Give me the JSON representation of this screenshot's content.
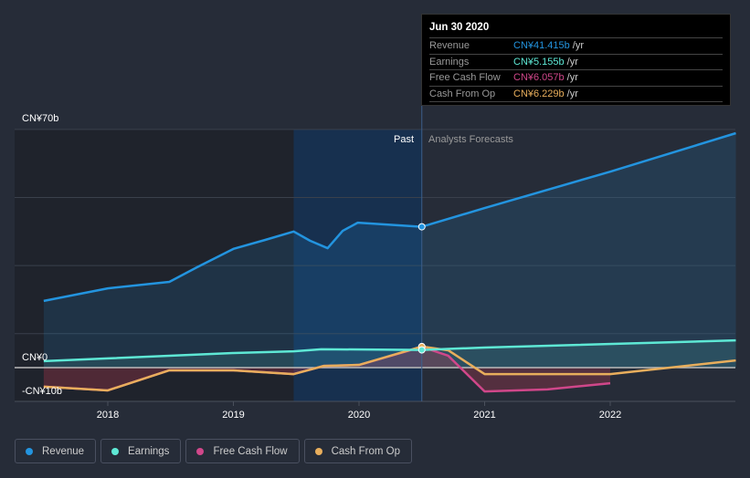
{
  "chart_data": {
    "type": "line",
    "y_unit": "CN¥ billions",
    "ylim": [
      -10,
      70
    ],
    "y_ticks": [
      {
        "v": 70,
        "label": "CN¥70b"
      },
      {
        "v": 0,
        "label": "CN¥0"
      },
      {
        "v": -10,
        "label": "-CN¥10b"
      }
    ],
    "x_ticks": [
      {
        "v": 2018,
        "label": "2018"
      },
      {
        "v": 2019,
        "label": "2019"
      },
      {
        "v": 2020,
        "label": "2020"
      },
      {
        "v": 2021,
        "label": "2021"
      },
      {
        "v": 2022,
        "label": "2022"
      }
    ],
    "xlim": [
      2017.2,
      2023.0
    ],
    "past_label": "Past",
    "forecast_label": "Analysts Forecasts",
    "divider_x": 2020.5,
    "highlight_start": 2019.48,
    "series": [
      {
        "name": "Revenue",
        "color": "#2394df",
        "x": [
          2017.49,
          2018.0,
          2018.49,
          2018.71,
          2019.0,
          2019.25,
          2019.48,
          2019.61,
          2019.75,
          2019.87,
          2019.99,
          2020.5,
          2021.0,
          2022.0,
          2023.0
        ],
        "values": [
          19.6,
          23.3,
          25.2,
          29.5,
          34.9,
          37.5,
          40.0,
          37.3,
          35.1,
          40.2,
          42.6,
          41.4,
          46.9,
          57.6,
          68.9
        ]
      },
      {
        "name": "Earnings",
        "color": "#5ee8d5",
        "x": [
          2017.49,
          2018.0,
          2019.0,
          2019.48,
          2019.7,
          2020.5,
          2021.0,
          2023.0
        ],
        "values": [
          1.9,
          2.7,
          4.3,
          4.8,
          5.4,
          5.2,
          5.9,
          8.0
        ]
      },
      {
        "name": "Free Cash Flow",
        "color": "#d0478a",
        "x": [
          2017.49,
          2018.0,
          2018.49,
          2019.0,
          2019.48,
          2019.72,
          2020.0,
          2020.5,
          2020.71,
          2021.0,
          2021.5,
          2022.0
        ],
        "values": [
          -5.6,
          -6.7,
          -0.8,
          -0.8,
          -1.9,
          0.5,
          0.8,
          6.1,
          3.5,
          -7.0,
          -6.4,
          -4.6
        ]
      },
      {
        "name": "Cash From Op",
        "color": "#e8ae5c",
        "x": [
          2017.49,
          2018.0,
          2018.49,
          2019.0,
          2019.48,
          2019.72,
          2020.0,
          2020.5,
          2020.71,
          2021.0,
          2022.0,
          2023.0
        ],
        "values": [
          -5.6,
          -6.7,
          -0.8,
          -0.8,
          -1.9,
          0.5,
          0.8,
          6.2,
          5.1,
          -1.9,
          -1.9,
          2.1
        ]
      }
    ],
    "tooltip": {
      "date": "Jun 30 2020",
      "rows": [
        {
          "label": "Revenue",
          "value": "CN¥41.415b",
          "unit": "/yr",
          "color": "#2394df"
        },
        {
          "label": "Earnings",
          "value": "CN¥5.155b",
          "unit": "/yr",
          "color": "#5ee8d5"
        },
        {
          "label": "Free Cash Flow",
          "value": "CN¥6.057b",
          "unit": "/yr",
          "color": "#d0478a"
        },
        {
          "label": "Cash From Op",
          "value": "CN¥6.229b",
          "unit": "/yr",
          "color": "#e8ae5c"
        }
      ]
    }
  }
}
